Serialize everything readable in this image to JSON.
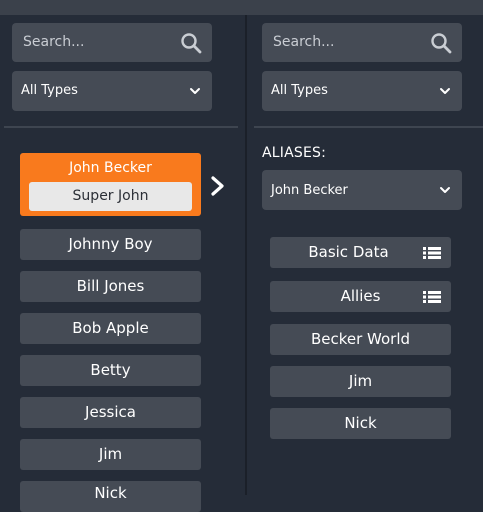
{
  "left": {
    "search": {
      "placeholder": "Search..."
    },
    "type_filter": {
      "value": "All Types"
    },
    "selected": {
      "name": "John Becker",
      "alias": "Super John"
    },
    "items": [
      "Johnny Boy",
      "Bill Jones",
      "Bob Apple",
      "Betty",
      "Jessica",
      "Jim",
      "Nick"
    ]
  },
  "right": {
    "search": {
      "placeholder": "Search..."
    },
    "type_filter": {
      "value": "All Types"
    },
    "aliases_title": "ALIASES:",
    "alias_select": {
      "value": "John Becker"
    },
    "items": [
      {
        "label": "Basic Data",
        "icon": "list-icon"
      },
      {
        "label": "Allies",
        "icon": "list-icon"
      },
      {
        "label": "Becker World"
      },
      {
        "label": "Jim"
      },
      {
        "label": "Nick"
      }
    ]
  },
  "colors": {
    "accent": "#f97a1d",
    "background": "#252c38",
    "control": "#454b55"
  }
}
